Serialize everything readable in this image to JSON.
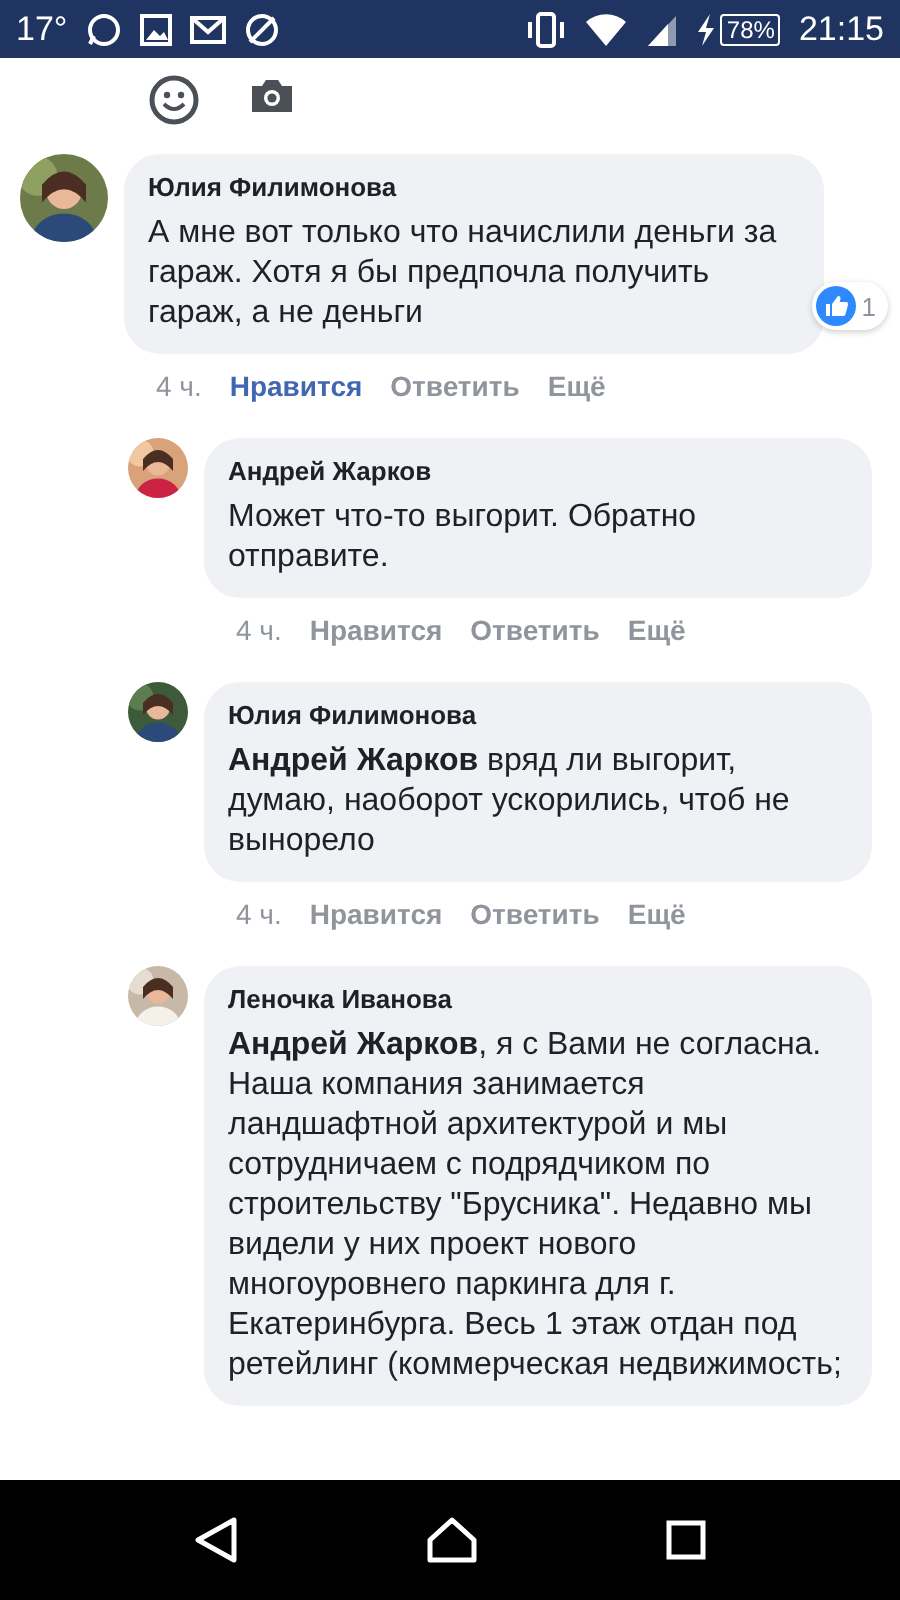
{
  "status_bar": {
    "temperature": "17°",
    "battery": "78%",
    "time": "21:15"
  },
  "comments": [
    {
      "author": "Юлия Филимонова",
      "text": "А мне вот только что начислили деньги за гараж. Хотя я бы предпочла получить гараж, а не деньги",
      "reactions": "1",
      "time": "4 ч.",
      "like": "Нравится",
      "liked": true,
      "reply": "Ответить",
      "more": "Ещё",
      "children": [
        {
          "author": "Андрей Жарков",
          "text": "Может что-то выгорит. Обратно отправите.",
          "time": "4 ч.",
          "like": "Нравится",
          "liked": false,
          "reply": "Ответить",
          "more": "Ещё"
        },
        {
          "author": "Юлия Филимонова",
          "text": "**Андрей Жарков** вряд ли выгорит, думаю, наоборот ускорились, чтоб не вынорело",
          "time": "4 ч.",
          "like": "Нравится",
          "liked": false,
          "reply": "Ответить",
          "more": "Ещё"
        },
        {
          "author": "Леночка Иванова",
          "text": "**Андрей Жарков**, я с Вами не согласна. Наша компания занимается ландшафтной архитектурой и мы сотрудничаем с подрядчиком по строительству \"Брусника\". Недавно мы видели у них проект нового многоуровнего паркинга для г. Екатеринбурга. Весь 1 этаж отдан под ретейлинг (коммерческая недвижимость;"
        }
      ]
    }
  ]
}
